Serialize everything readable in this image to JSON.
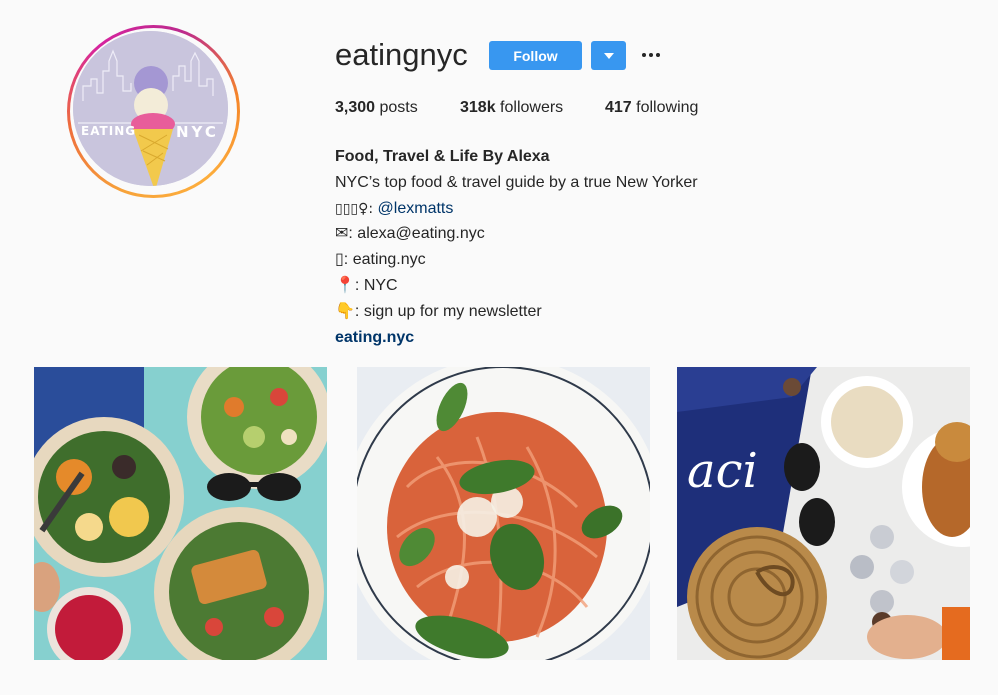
{
  "profile": {
    "username": "eatingnyc",
    "avatar_text_left": "EATING",
    "avatar_text_right": "NYC",
    "follow_label": "Follow",
    "dropdown_icon": "chevron-down-icon",
    "more_icon": "more-options-icon"
  },
  "stats": {
    "posts_count": "3,300",
    "posts_label": "posts",
    "followers_count": "318k",
    "followers_label": "followers",
    "following_count": "417",
    "following_label": "following"
  },
  "bio": {
    "name": "Food, Travel & Life By Alexa",
    "tagline": "NYC’s top food & travel guide by a true New Yorker",
    "line3_prefix": "▯▯▯♀: ",
    "line3_handle": "@lexmatts",
    "line4": "✉: alexa@eating.nyc",
    "line5": "▯: eating.nyc",
    "line6": "📍: NYC",
    "line7": "👇: sign up for my newsletter",
    "website": "eating.nyc"
  },
  "colors": {
    "accent": "#3897f0",
    "link": "#003569",
    "background": "#fafafa"
  },
  "posts": [
    {
      "subject": "grain bowls and salads with sunglasses"
    },
    {
      "subject": "spaghetti with tomato sauce and basil"
    },
    {
      "subject": "baci chocolates, coffee, croissant and rattan bag"
    }
  ]
}
